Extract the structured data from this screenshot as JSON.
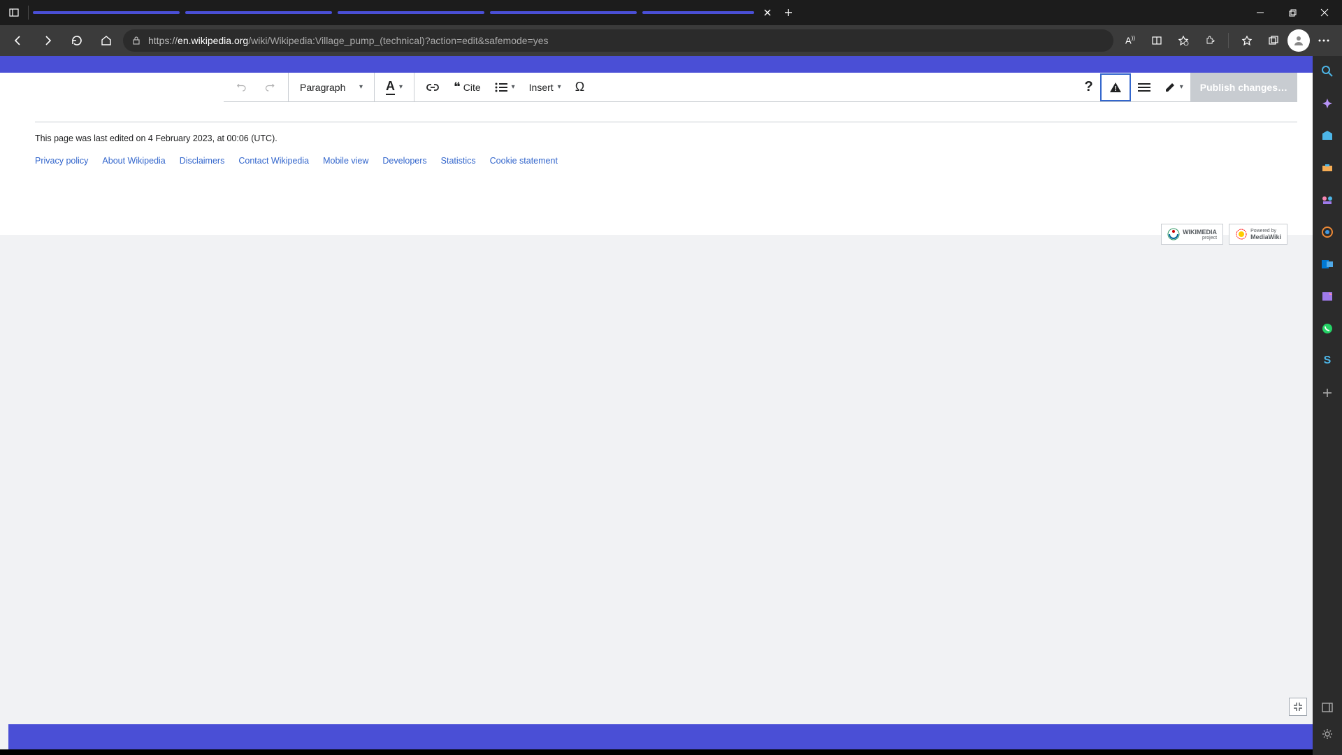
{
  "browser": {
    "url_prefix": "https://",
    "url_domain": "en.wikipedia.org",
    "url_path": "/wiki/Wikipedia:Village_pump_(technical)?action=edit&safemode=yes"
  },
  "toolbar": {
    "paragraph_label": "Paragraph",
    "cite_label": "Cite",
    "insert_label": "Insert",
    "publish_label": "Publish changes…"
  },
  "page": {
    "last_edited": "This page was last edited on 4 February 2023, at 00:06 (UTC)."
  },
  "footer_links": {
    "privacy": "Privacy policy",
    "about": "About Wikipedia",
    "disclaimers": "Disclaimers",
    "contact": "Contact Wikipedia",
    "mobile": "Mobile view",
    "developers": "Developers",
    "statistics": "Statistics",
    "cookie": "Cookie statement"
  },
  "logos": {
    "wikimedia_top": "WIKIMEDIA",
    "wikimedia_bottom": "project",
    "mediawiki_top": "Powered by",
    "mediawiki_bottom": "MediaWiki"
  }
}
